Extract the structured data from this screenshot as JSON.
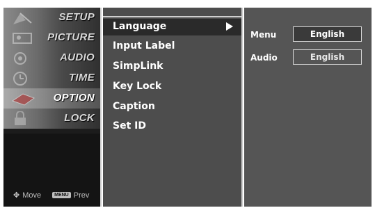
{
  "categories": [
    {
      "label": "SETUP",
      "icon": "satellite-dish-icon"
    },
    {
      "label": "PICTURE",
      "icon": "picture-icon"
    },
    {
      "label": "AUDIO",
      "icon": "speaker-icon"
    },
    {
      "label": "TIME",
      "icon": "clock-icon"
    },
    {
      "label": "OPTION",
      "icon": "option-tag-icon"
    },
    {
      "label": "LOCK",
      "icon": "lock-icon"
    }
  ],
  "selected_category": "OPTION",
  "hints": {
    "move_label": "Move",
    "menu_key": "MENU",
    "prev_label": "Prev"
  },
  "submenu": [
    {
      "label": "Language"
    },
    {
      "label": "Input Label"
    },
    {
      "label": "SimpLink"
    },
    {
      "label": "Key Lock"
    },
    {
      "label": "Caption"
    },
    {
      "label": "Set ID"
    }
  ],
  "selected_submenu": "Language",
  "settings": [
    {
      "label": "Menu",
      "value": "English"
    },
    {
      "label": "Audio",
      "value": "English"
    }
  ],
  "colors": {
    "background": "#5b5b5b",
    "highlight": "#2a2a2a",
    "text": "#ffffff"
  }
}
